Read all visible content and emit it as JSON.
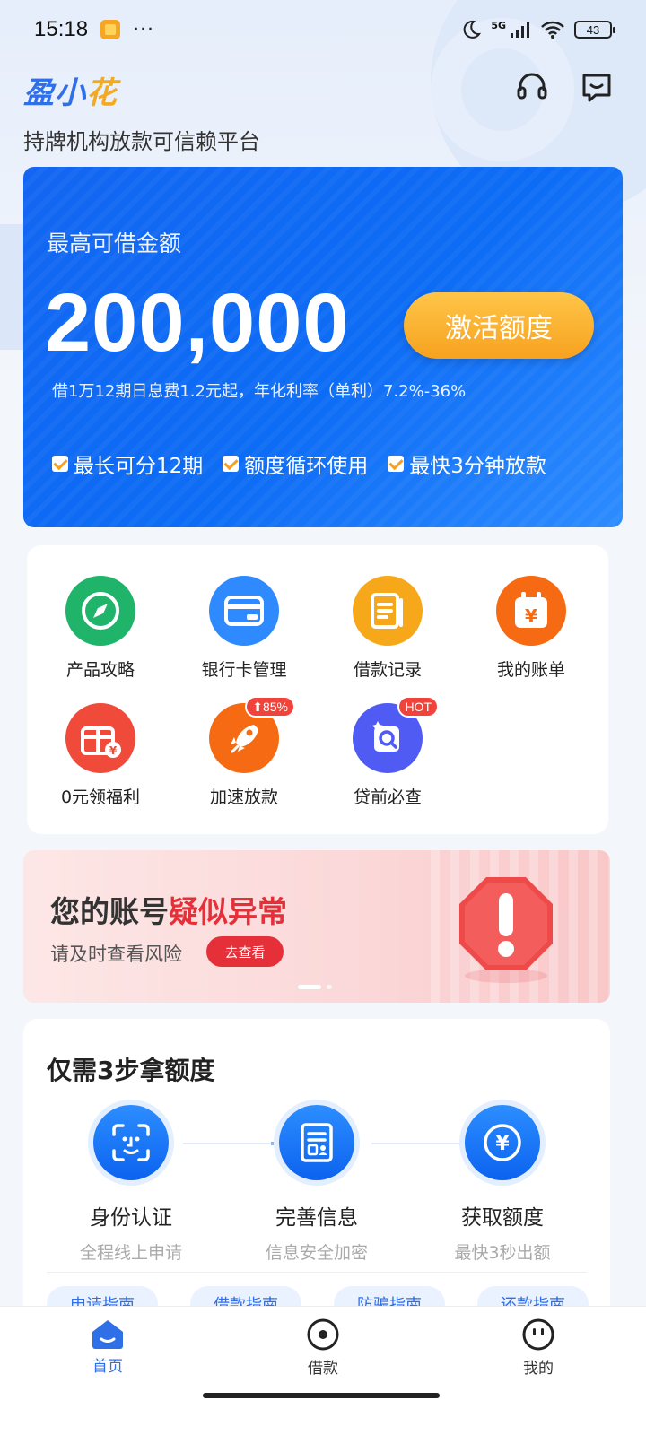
{
  "status_bar": {
    "time": "15:18",
    "more": "···",
    "network": "5G",
    "battery": "43"
  },
  "header": {
    "brand_main": "盈小",
    "brand_accent": "花",
    "tagline": "持牌机构放款可信赖平台",
    "icons": [
      "headset-icon",
      "message-icon"
    ]
  },
  "hero": {
    "label": "最高可借金额",
    "amount": "200,000",
    "activate_label": "激活额度",
    "rate_text": "借1万12期日息费1.2元起，年化利率（单利）7.2%-36%",
    "features": [
      "最长可分12期",
      "额度循环使用",
      "最快3分钟放款"
    ]
  },
  "menu": {
    "items": [
      {
        "label": "产品攻略",
        "icon": "compass-icon",
        "color": "#1fb46a"
      },
      {
        "label": "银行卡管理",
        "icon": "card-icon",
        "color": "#2f8aff"
      },
      {
        "label": "借款记录",
        "icon": "document-icon",
        "color": "#f7a81a"
      },
      {
        "label": "我的账单",
        "icon": "calendar-yen-icon",
        "color": "#f56a12"
      },
      {
        "label": "0元领福利",
        "icon": "gift-icon",
        "color": "#f04b3a"
      },
      {
        "label": "加速放款",
        "icon": "rocket-icon",
        "color": "#f56a12",
        "badge": "85%"
      },
      {
        "label": "贷前必查",
        "icon": "search-doc-icon",
        "color": "#4f5bf2",
        "badge": "HOT"
      }
    ]
  },
  "banner": {
    "title_prefix": "您的账号",
    "title_warn": "疑似异常",
    "subtitle": "请及时查看风险",
    "button": "去查看"
  },
  "steps": {
    "title": "仅需3步拿额度",
    "items": [
      {
        "title": "身份认证",
        "sub": "全程线上申请",
        "icon": "face-id-icon"
      },
      {
        "title": "完善信息",
        "sub": "信息安全加密",
        "icon": "id-card-icon"
      },
      {
        "title": "获取额度",
        "sub": "最快3秒出额",
        "icon": "yen-circle-icon"
      }
    ],
    "guides": [
      "申请指南",
      "借款指南",
      "防骗指南",
      "还款指南"
    ]
  },
  "bottom_nav": {
    "items": [
      {
        "label": "首页",
        "icon": "home-icon",
        "active": true
      },
      {
        "label": "借款",
        "icon": "borrow-icon",
        "active": false
      },
      {
        "label": "我的",
        "icon": "profile-icon",
        "active": false
      }
    ]
  },
  "colors": {
    "primary": "#2f6fe8",
    "hero_blue": "#1266f2",
    "orange": "#f7a21f",
    "warn_red": "#e5303a"
  }
}
